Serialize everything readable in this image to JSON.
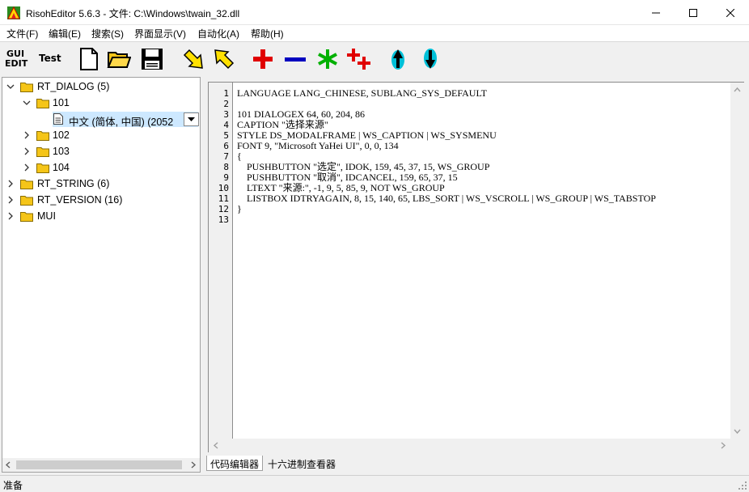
{
  "window": {
    "title": "RisohEditor 5.6.3 - 文件: C:\\Windows\\twain_32.dll"
  },
  "menu": {
    "items": [
      "文件(F)",
      "编辑(E)",
      "搜索(S)",
      "界面显示(V)",
      "自动化(A)",
      "帮助(H)"
    ]
  },
  "toolbar": {
    "gui_edit_line1": "GUI",
    "gui_edit_line2": "EDIT",
    "test_label": "Test"
  },
  "tree": {
    "items": [
      {
        "label": "RT_DIALOG (5)"
      },
      {
        "label": "101"
      },
      {
        "label": "中文 (简体, 中国)  (2052"
      },
      {
        "label": "102"
      },
      {
        "label": "103"
      },
      {
        "label": "104"
      },
      {
        "label": "RT_STRING (6)"
      },
      {
        "label": "RT_VERSION (16)"
      },
      {
        "label": "MUI"
      }
    ]
  },
  "editor": {
    "line_numbers": [
      "1",
      "2",
      "3",
      "4",
      "5",
      "6",
      "7",
      "8",
      "9",
      "10",
      "11",
      "12",
      "13"
    ],
    "lines": [
      "LANGUAGE LANG_CHINESE, SUBLANG_SYS_DEFAULT",
      "",
      "101 DIALOGEX 64, 60, 204, 86",
      "CAPTION \"选择来源\"",
      "STYLE DS_MODALFRAME | WS_CAPTION | WS_SYSMENU",
      "FONT 9, \"Microsoft YaHei UI\", 0, 0, 134",
      "{",
      "    PUSHBUTTON \"选定\", IDOK, 159, 45, 37, 15, WS_GROUP",
      "    PUSHBUTTON \"取消\", IDCANCEL, 159, 65, 37, 15",
      "    LTEXT \"来源:\", -1, 9, 5, 85, 9, NOT WS_GROUP",
      "    LISTBOX IDTRYAGAIN, 8, 15, 140, 65, LBS_SORT | WS_VSCROLL | WS_GROUP | WS_TABSTOP",
      "}",
      ""
    ]
  },
  "tabs": {
    "code_editor": "代码编辑器",
    "hex_viewer": "十六进制查看器"
  },
  "status": {
    "text": "准备"
  },
  "colors": {
    "selection": "#cde8ff",
    "folder": "#f5c518",
    "plus_red": "#e00000",
    "minus_blue": "#0000c0",
    "star_green": "#00c000",
    "arrow_yellow": "#ffe000",
    "nav_cyan": "#00c0d8"
  }
}
